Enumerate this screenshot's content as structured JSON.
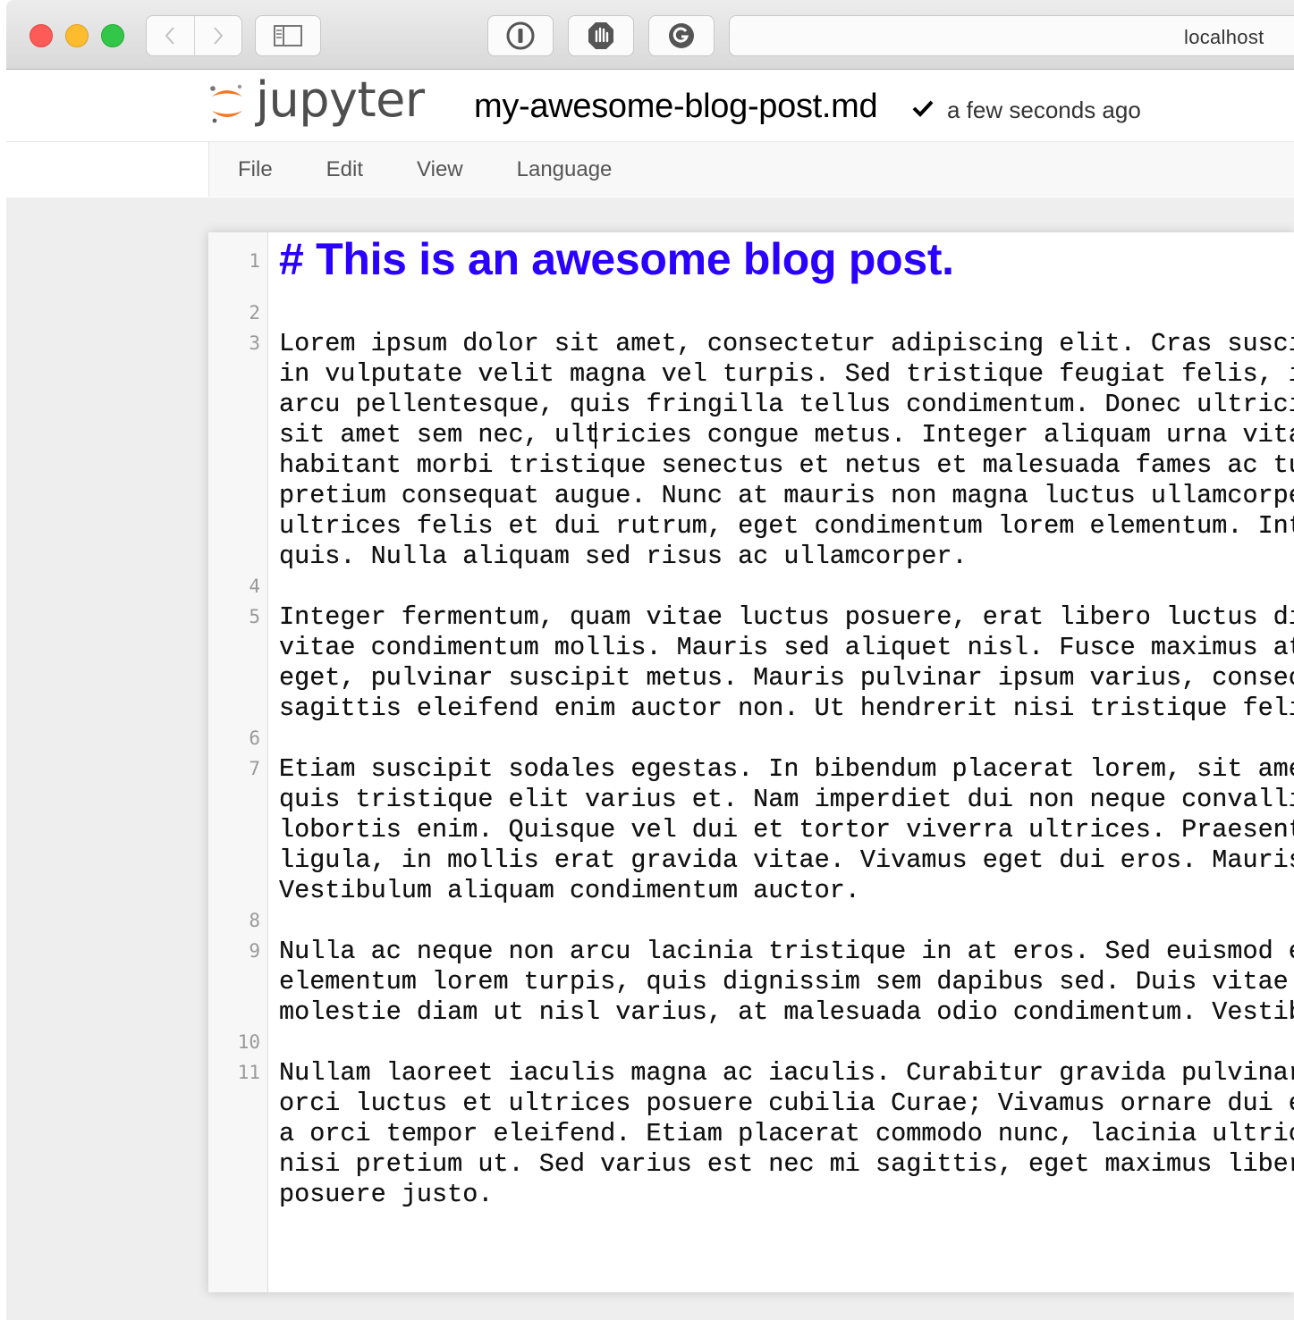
{
  "browser": {
    "url": "localhost",
    "icons": {
      "back": "chevron-left-icon",
      "forward": "chevron-right-icon",
      "sidebar": "sidebar-icon",
      "ext1": "password-manager-icon",
      "ext2": "ad-block-icon",
      "ext3": "grammarly-icon"
    }
  },
  "header": {
    "logo_text": "jupyter",
    "file_name": "my-awesome-blog-post.md",
    "save_status": "a few seconds ago"
  },
  "menu": {
    "file": "File",
    "edit": "Edit",
    "view": "View",
    "language": "Language"
  },
  "editor": {
    "heading_color": "#2a00ff",
    "lines": [
      {
        "num": "1",
        "text": "# This is an awesome blog post."
      },
      {
        "num": "2",
        "text": ""
      },
      {
        "num": "3",
        "text": [
          "Lorem ipsum dolor sit amet, consectetur adipiscing elit. Cras suscip",
          "in vulputate velit magna vel turpis. Sed tristique feugiat felis, id",
          "arcu pellentesque, quis fringilla tellus condimentum. Donec ultricie",
          "sit amet sem nec, ultricies congue metus. Integer aliquam urna vitae",
          "habitant morbi tristique senectus et netus et malesuada fames ac tur",
          "pretium consequat augue. Nunc at mauris non magna luctus ullamcorper",
          "ultrices felis et dui rutrum, eget condimentum lorem elementum. Inte",
          "quis. Nulla aliquam sed risus ac ullamcorper."
        ]
      },
      {
        "num": "4",
        "text": ""
      },
      {
        "num": "5",
        "text": [
          "Integer fermentum, quam vitae luctus posuere, erat libero luctus dia",
          "vitae condimentum mollis. Mauris sed aliquet nisl. Fusce maximus at",
          "eget, pulvinar suscipit metus. Mauris pulvinar ipsum varius, consect",
          "sagittis eleifend enim auctor non. Ut hendrerit nisi tristique felis"
        ]
      },
      {
        "num": "6",
        "text": ""
      },
      {
        "num": "7",
        "text": [
          "Etiam suscipit sodales egestas. In bibendum placerat lorem, sit amet",
          "quis tristique elit varius et. Nam imperdiet dui non neque convallis",
          "lobortis enim. Quisque vel dui et tortor viverra ultrices. Praesent",
          "ligula, in mollis erat gravida vitae. Vivamus eget dui eros. Mauris",
          "Vestibulum aliquam condimentum auctor."
        ]
      },
      {
        "num": "8",
        "text": ""
      },
      {
        "num": "9",
        "text": [
          "Nulla ac neque non arcu lacinia tristique in at eros. Sed euismod er",
          "elementum lorem turpis, quis dignissim sem dapibus sed. Duis vitae e",
          "molestie diam ut nisl varius, at malesuada odio condimentum. Vestibu"
        ]
      },
      {
        "num": "10",
        "text": ""
      },
      {
        "num": "11",
        "text": [
          "Nullam laoreet iaculis magna ac iaculis. Curabitur gravida pulvinar",
          "orci luctus et ultrices posuere cubilia Curae; Vivamus ornare dui er",
          "a orci tempor eleifend. Etiam placerat commodo nunc, lacinia ultrice",
          "nisi pretium ut. Sed varius est nec mi sagittis, eget maximus libero",
          "posuere justo."
        ]
      }
    ]
  }
}
